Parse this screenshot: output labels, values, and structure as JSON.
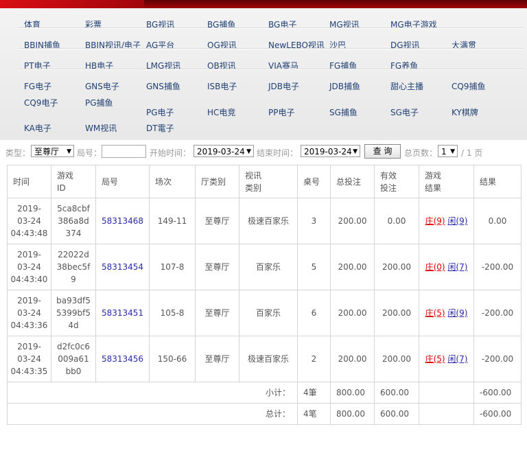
{
  "games": [
    [
      "体育",
      "彩票",
      "BG视讯",
      "BG捕鱼",
      "BG电子",
      "MG视讯",
      "MG电子游戏"
    ],
    [
      "BBIN捕鱼",
      "BBIN视讯/电子",
      "AG平台",
      "OG视讯",
      "NewLEBO视讯",
      "沙巴",
      "DG视讯",
      "大满贯"
    ],
    [
      "PT电子",
      "HB电子",
      "LMG视讯",
      "OB视讯",
      "VIA赛马",
      "FG捕鱼",
      "FG养鱼"
    ],
    [
      "FG电子",
      "GNS电子",
      "GNS捕鱼",
      "ISB电子",
      "JDB电子",
      "JDB捕鱼",
      "甜心主播",
      "CQ9捕鱼"
    ],
    [
      "CQ9电子",
      "PG捕鱼",
      "PG电子",
      "HC电竞",
      "PP电子",
      "SG捕鱼",
      "SG电子",
      "KY棋牌"
    ],
    [
      "KA电子",
      "WM视讯",
      "DT電子"
    ]
  ],
  "filter": {
    "type_label": "类型：",
    "type_value": "至尊厅",
    "round_label": "局号：",
    "round_value": "",
    "start_label": "开始时间：",
    "start_value": "2019-03-24",
    "end_label": "结束时间：",
    "end_value": "2019-03-24",
    "query_button": "查 询",
    "pages_label": "总页数：",
    "page_value": "1",
    "page_total": "/ 1 页"
  },
  "table": {
    "headers": [
      "时间",
      "游戏\nID",
      "局号",
      "场次",
      "厅类别",
      "视讯\n类别",
      "桌号",
      "总投注",
      "有效\n投注",
      "游戏\n结果",
      "结果"
    ],
    "rows": [
      {
        "time": "2019-\n03-24\n04:43:48",
        "game_id": "5ca8cbf\n386a8d\n374",
        "round": "58313468",
        "session": "149-11",
        "hall": "至尊厅",
        "video_type": "极速百家乐",
        "table_no": "3",
        "total_bet": "200.00",
        "valid_bet": "0.00",
        "banker": "庄(9)",
        "player": "闲(9)",
        "result": "0.00"
      },
      {
        "time": "2019-\n03-24\n04:43:40",
        "game_id": "22022d\n38bec5f\n9",
        "round": "58313454",
        "session": "107-8",
        "hall": "至尊厅",
        "video_type": "百家乐",
        "table_no": "5",
        "total_bet": "200.00",
        "valid_bet": "200.00",
        "banker": "庄(0)",
        "player": "闲(7)",
        "result": "-200.00"
      },
      {
        "time": "2019-\n03-24\n04:43:36",
        "game_id": "ba93df5\n5399bf5\n4d",
        "round": "58313451",
        "session": "105-8",
        "hall": "至尊厅",
        "video_type": "百家乐",
        "table_no": "6",
        "total_bet": "200.00",
        "valid_bet": "200.00",
        "banker": "庄(5)",
        "player": "闲(9)",
        "result": "-200.00"
      },
      {
        "time": "2019-\n03-24\n04:43:35",
        "game_id": "d2fc0c6\n009a61\nbb0",
        "round": "58313456",
        "session": "150-66",
        "hall": "至尊厅",
        "video_type": "极速百家乐",
        "table_no": "2",
        "total_bet": "200.00",
        "valid_bet": "200.00",
        "banker": "庄(5)",
        "player": "闲(7)",
        "result": "-200.00"
      }
    ],
    "subtotal": {
      "label": "小计：",
      "count": "4筆",
      "total_bet": "800.00",
      "valid_bet": "600.00",
      "result": "-600.00"
    },
    "total": {
      "label": "总计：",
      "count": "4笔",
      "total_bet": "800.00",
      "valid_bet": "600.00",
      "result": "-600.00"
    }
  }
}
